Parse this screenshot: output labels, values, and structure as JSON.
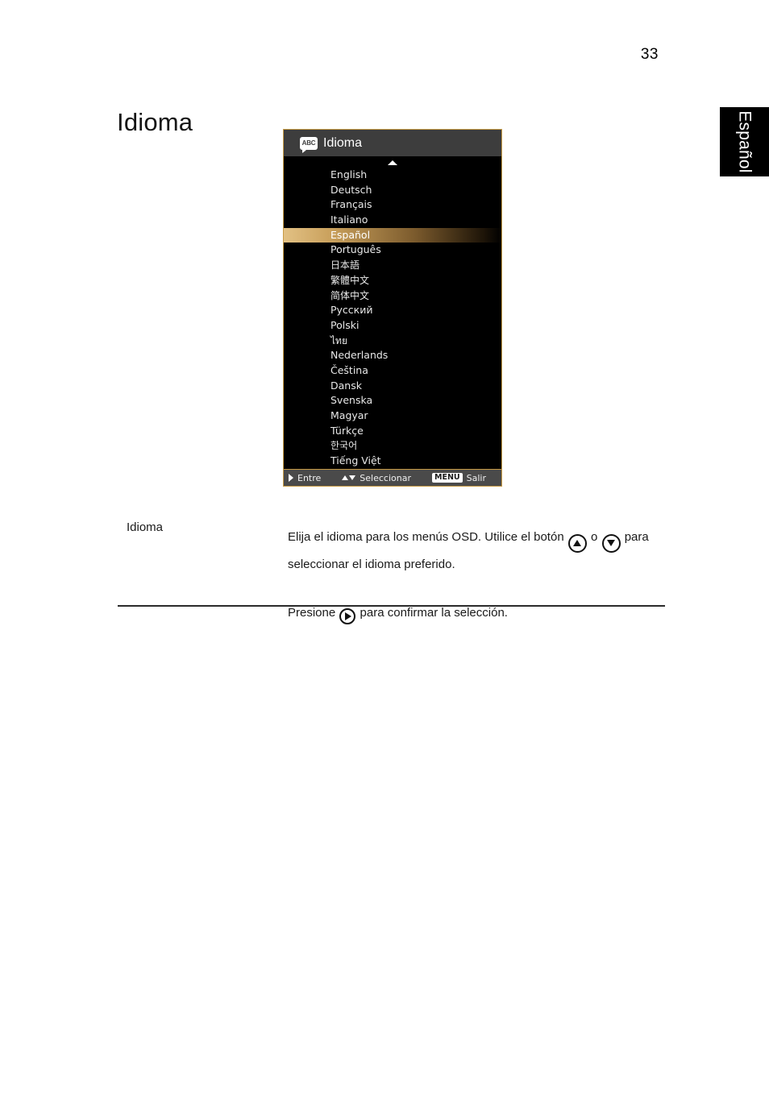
{
  "page": {
    "number": "33",
    "side_tab": "Español",
    "heading": "Idioma"
  },
  "osd": {
    "title": "Idioma",
    "icon": "abc-speech-bubble-icon",
    "icon_text": "ABC",
    "scroll_up_icon": "triangle-up-icon",
    "scroll_down_icon": "triangle-down-icon",
    "selected_language": "Español",
    "border_color": "#c89b45",
    "header_color": "#3d3d3d",
    "highlight_color": "#e2c184",
    "languages": [
      {
        "label": "English",
        "selected": false
      },
      {
        "label": "Deutsch",
        "selected": false
      },
      {
        "label": "Français",
        "selected": false
      },
      {
        "label": "Italiano",
        "selected": false
      },
      {
        "label": "Español",
        "selected": true
      },
      {
        "label": "Português",
        "selected": false
      },
      {
        "label": "日本語",
        "selected": false
      },
      {
        "label": "繁體中文",
        "selected": false
      },
      {
        "label": "简体中文",
        "selected": false
      },
      {
        "label": "Русский",
        "selected": false
      },
      {
        "label": "Polski",
        "selected": false
      },
      {
        "label": "ไทย",
        "selected": false
      },
      {
        "label": "Nederlands",
        "selected": false
      },
      {
        "label": "Čeština",
        "selected": false
      },
      {
        "label": "Dansk",
        "selected": false
      },
      {
        "label": "Svenska",
        "selected": false
      },
      {
        "label": "Magyar",
        "selected": false
      },
      {
        "label": "Türkçe",
        "selected": false
      },
      {
        "label": "한국어",
        "selected": false
      },
      {
        "label": "Tiếng Việt",
        "selected": false
      }
    ],
    "footer": {
      "enter_icon": "triangle-right-icon",
      "enter_label": "Entre",
      "select_up_icon": "triangle-up-icon",
      "select_down_icon": "triangle-down-icon",
      "select_label": "Seleccionar",
      "menu_key": "MENU",
      "exit_label": "Salir"
    }
  },
  "description": {
    "label": "Idioma",
    "para1_part1": "Elija el idioma para los menús OSD. Utilice el botón",
    "para1_or": "o",
    "para1_part2": "para seleccionar el idioma preferido.",
    "para2_part1": "Presione",
    "para2_part2": "para confirmar la selección.",
    "up_button_icon": "circled-triangle-up-icon",
    "down_button_icon": "circled-triangle-down-icon",
    "enter_button_icon": "circled-triangle-right-icon"
  }
}
